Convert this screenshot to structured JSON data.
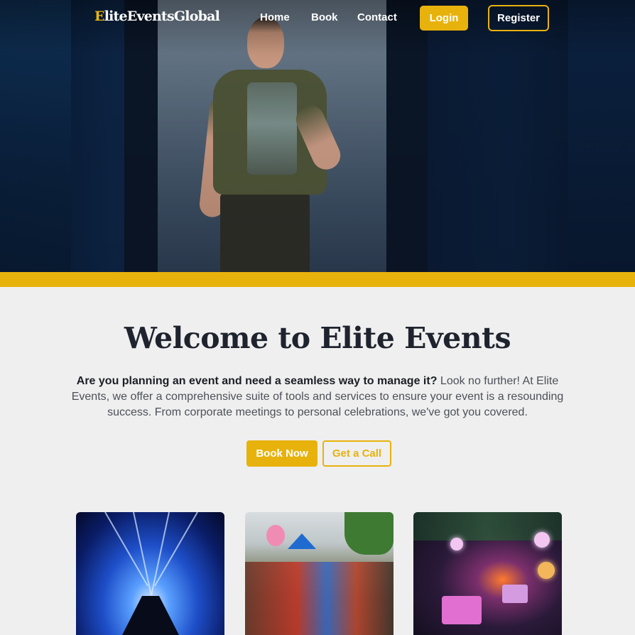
{
  "brand": {
    "logo_initial": "E",
    "logo_rest": "liteEventsGlobal",
    "accent_color": "#e8b20d"
  },
  "nav": {
    "links": [
      {
        "label": "Home"
      },
      {
        "label": "Book"
      },
      {
        "label": "Contact"
      }
    ],
    "login_label": "Login",
    "register_label": "Register"
  },
  "hero": {
    "image": "speaker-on-stage-photo"
  },
  "welcome": {
    "title": "Welcome to Elite Events",
    "lead_bold": "Are you planning an event and need a seamless way to manage it?",
    "body": " Look no further! At Elite Events, we offer a comprehensive suite of tools and services to ensure your event is a resounding success. From corporate meetings to personal celebrations, we've got you covered.",
    "book_now_label": "Book Now",
    "get_call_label": "Get a Call"
  },
  "gallery": [
    {
      "image": "concert-stage-lights-photo"
    },
    {
      "image": "crowd-celebration-photo"
    },
    {
      "image": "garden-party-lounge-photo"
    }
  ]
}
